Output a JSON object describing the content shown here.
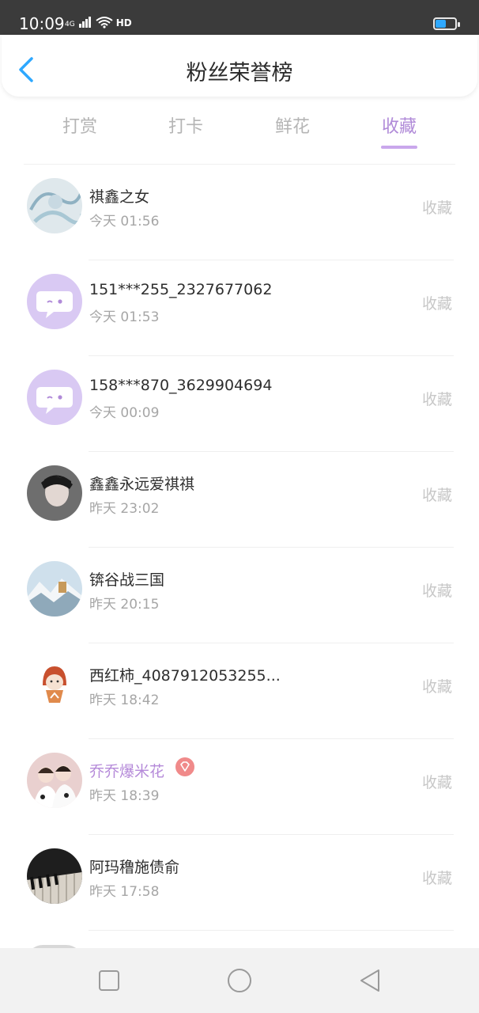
{
  "status_bar": {
    "time": "10:09",
    "network": "4G",
    "hd": "HD",
    "battery_level_percent": 55,
    "battery_color": "#2ea8ff"
  },
  "header": {
    "title": "粉丝荣誉榜",
    "back_icon": "chevron-left-icon",
    "accent_color": "#2ea8ff"
  },
  "tabs": [
    {
      "label": "打赏",
      "active": false
    },
    {
      "label": "打卡",
      "active": false
    },
    {
      "label": "鲜花",
      "active": false
    },
    {
      "label": "收藏",
      "active": true
    }
  ],
  "accent_color": "#b08ad8",
  "fans": [
    {
      "name": "祺鑫之女",
      "time": "今天 01:56",
      "action": "收藏",
      "avatar": "anime-art",
      "vip": false
    },
    {
      "name": "151***255_2327677062",
      "time": "今天 01:53",
      "action": "收藏",
      "avatar": "default-chat-bubble",
      "vip": false
    },
    {
      "name": "158***870_3629904694",
      "time": "今天 00:09",
      "action": "收藏",
      "avatar": "default-chat-bubble",
      "vip": false
    },
    {
      "name": "鑫鑫永远爱祺祺",
      "time": "昨天 23:02",
      "action": "收藏",
      "avatar": "portrait-photo",
      "vip": false
    },
    {
      "name": "锛谷战三国",
      "time": "昨天 20:15",
      "action": "收藏",
      "avatar": "snow-landscape",
      "vip": false
    },
    {
      "name": "西红柿_4087912053255...",
      "time": "昨天 18:42",
      "action": "收藏",
      "avatar": "cartoon-character",
      "vip": false
    },
    {
      "name": "乔乔爆米花",
      "time": "昨天 18:39",
      "action": "收藏",
      "avatar": "couple-photo",
      "vip": true
    },
    {
      "name": "阿玛穞施债俞",
      "time": "昨天 17:58",
      "action": "收藏",
      "avatar": "piano-keys",
      "vip": false
    }
  ],
  "nav_bar": {
    "items": [
      "square-icon",
      "circle-icon",
      "triangle-back-icon"
    ]
  }
}
